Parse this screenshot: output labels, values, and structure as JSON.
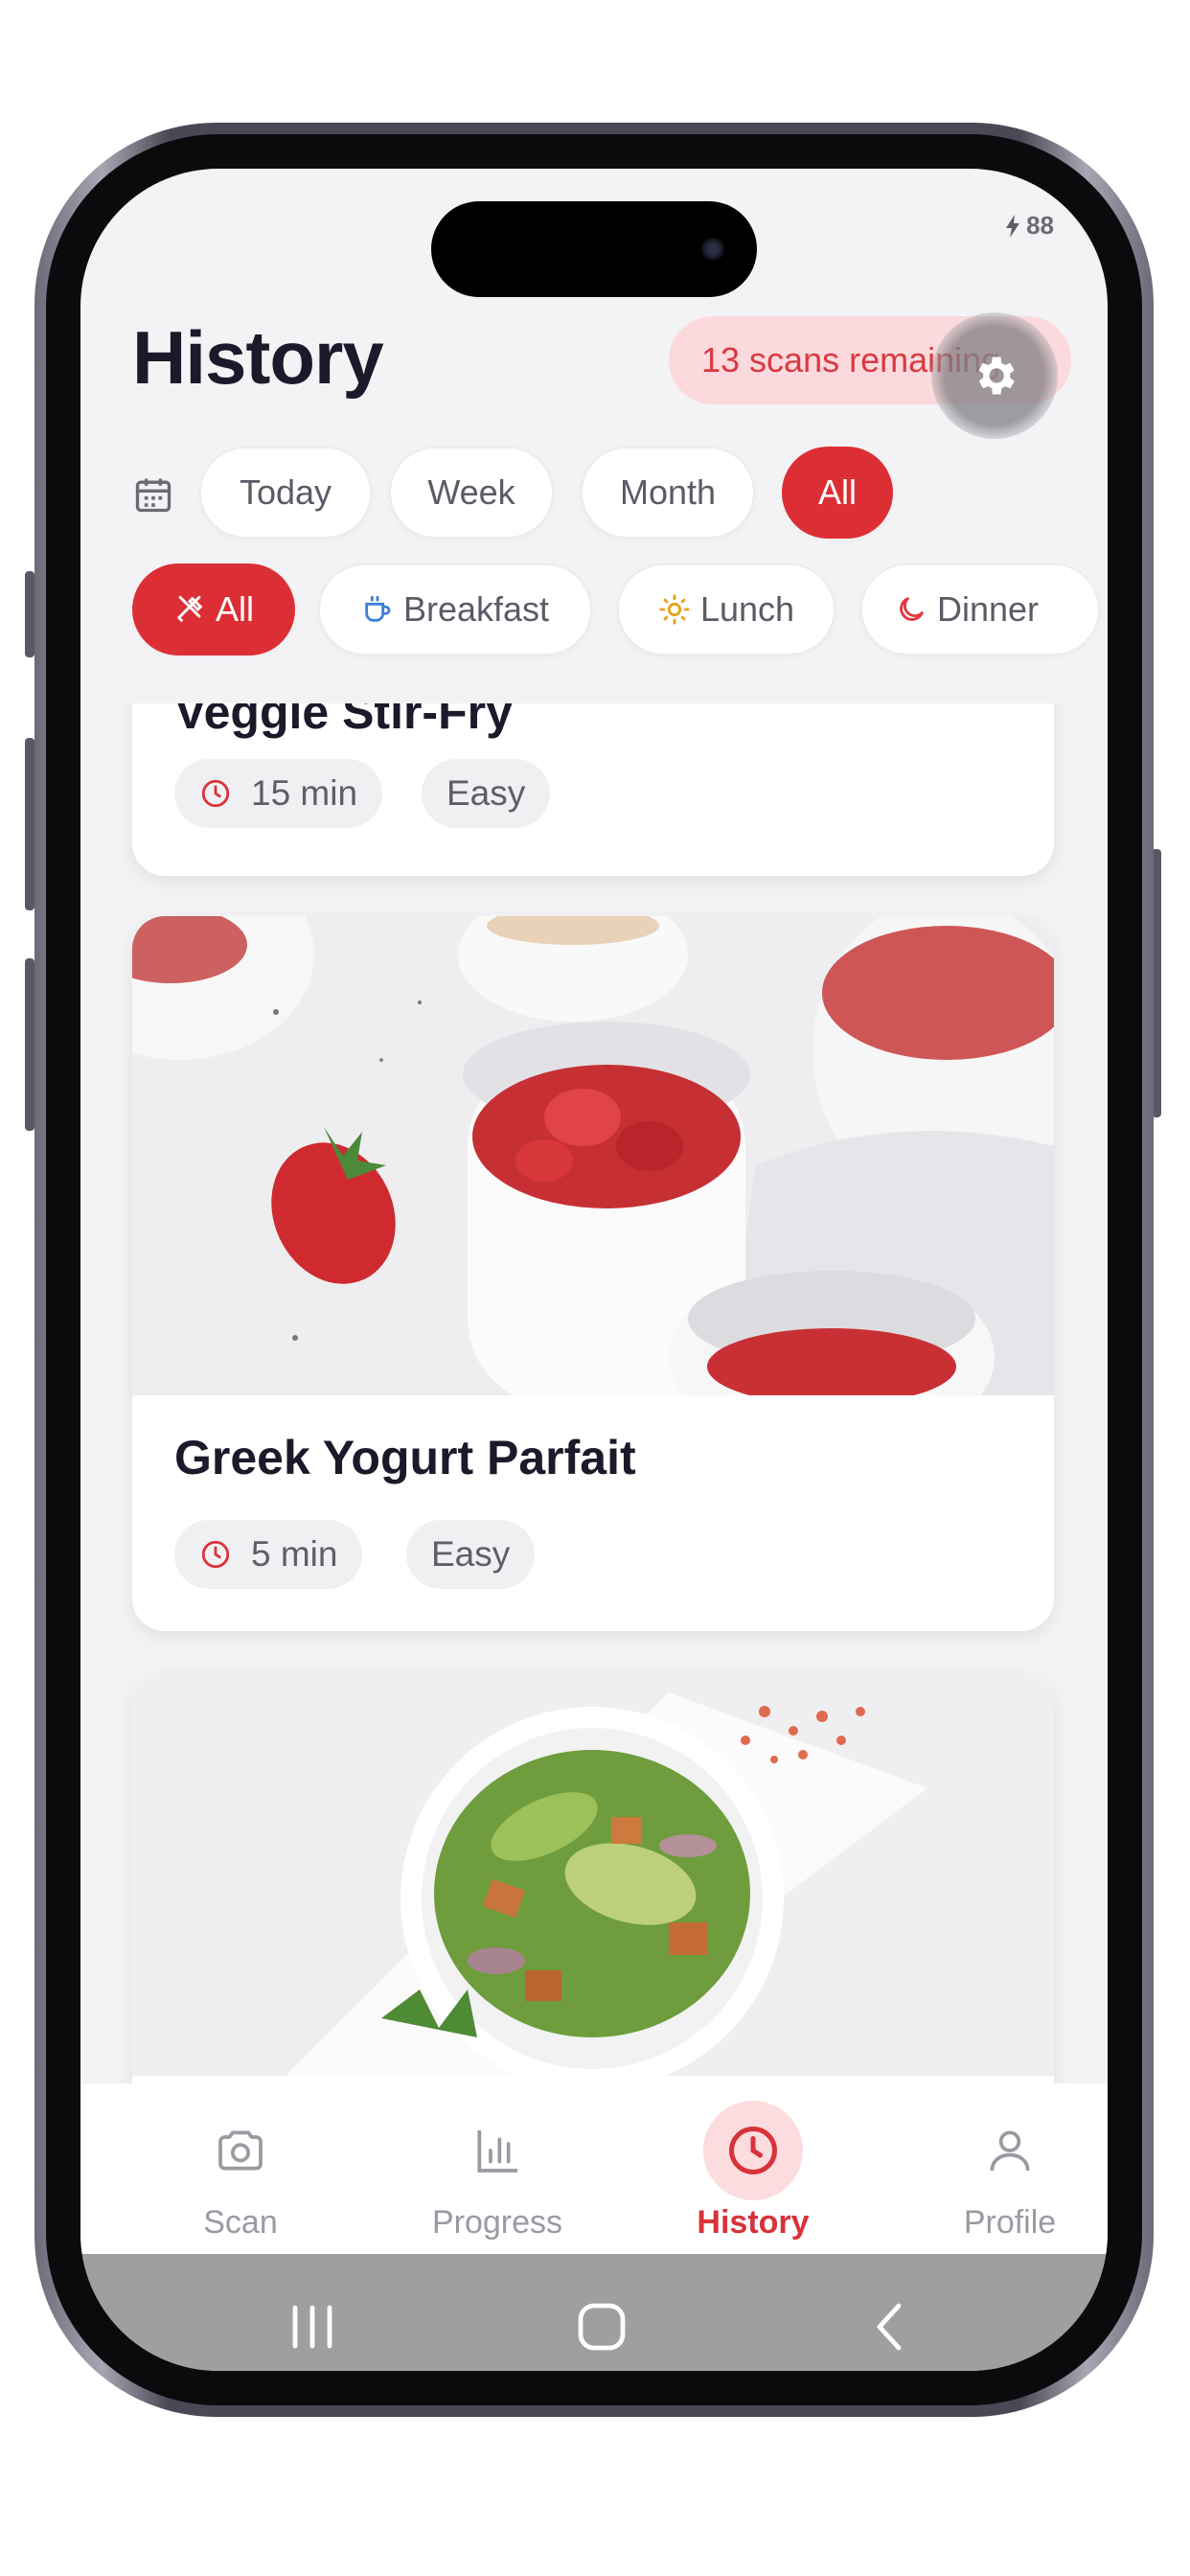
{
  "status_bar": {
    "battery": "88",
    "left_text": "",
    "charging_icon": "bolt-icon"
  },
  "header": {
    "title": "History",
    "scans_remaining": "13 scans remaining",
    "settings_icon": "gear-icon"
  },
  "date_filters": [
    {
      "label": "Today",
      "active": false
    },
    {
      "label": "Week",
      "active": false
    },
    {
      "label": "Month",
      "active": false
    },
    {
      "label": "All",
      "active": true
    }
  ],
  "meal_filters": [
    {
      "label": "All",
      "icon": "utensils-icon",
      "active": true
    },
    {
      "label": "Breakfast",
      "icon": "coffee-cup-icon",
      "active": false
    },
    {
      "label": "Lunch",
      "icon": "sun-icon",
      "active": false
    },
    {
      "label": "Dinner",
      "icon": "moon-icon",
      "active": false
    }
  ],
  "meals": [
    {
      "title": "Veggie Stir-Fry",
      "time": "15 min",
      "difficulty": "Easy"
    },
    {
      "title": "Greek Yogurt Parfait",
      "time": "5 min",
      "difficulty": "Easy"
    },
    {
      "title": "",
      "time": "",
      "difficulty": ""
    }
  ],
  "bottom_nav": [
    {
      "label": "Scan",
      "icon": "camera-icon",
      "active": false
    },
    {
      "label": "Progress",
      "icon": "bar-chart-icon",
      "active": false
    },
    {
      "label": "History",
      "icon": "clock-icon",
      "active": true
    },
    {
      "label": "Profile",
      "icon": "user-icon",
      "active": false
    }
  ],
  "colors": {
    "accent": "#dc2f35",
    "accent_soft": "#fbd9dc",
    "background": "#f3f3f6"
  }
}
